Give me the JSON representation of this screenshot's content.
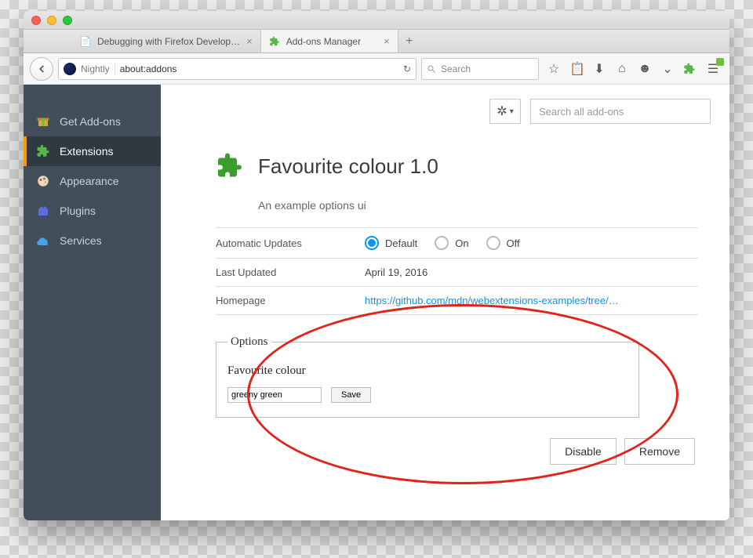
{
  "tabs": {
    "t0": {
      "label": "Debugging with Firefox Develop…"
    },
    "t1": {
      "label": "Add-ons Manager"
    }
  },
  "url": {
    "identity": "Nightly",
    "value": "about:addons"
  },
  "search": {
    "placeholder": "Search"
  },
  "sidebar": {
    "items": {
      "get": {
        "label": "Get Add-ons"
      },
      "ext": {
        "label": "Extensions"
      },
      "app": {
        "label": "Appearance"
      },
      "plug": {
        "label": "Plugins"
      },
      "serv": {
        "label": "Services"
      }
    }
  },
  "addons_search": {
    "placeholder": "Search all add-ons"
  },
  "addon": {
    "title": "Favourite colour 1.0",
    "description": "An example options ui",
    "rows": {
      "updates_label": "Automatic Updates",
      "updates_opts": {
        "default": "Default",
        "on": "On",
        "off": "Off"
      },
      "last_updated_label": "Last Updated",
      "last_updated_value": "April 19, 2016",
      "homepage_label": "Homepage",
      "homepage_value": "https://github.com/mdn/webextensions-examples/tree/…"
    },
    "options": {
      "legend": "Options",
      "field_label": "Favourite colour",
      "field_value": "greeny green",
      "save": "Save"
    },
    "actions": {
      "disable": "Disable",
      "remove": "Remove"
    }
  }
}
